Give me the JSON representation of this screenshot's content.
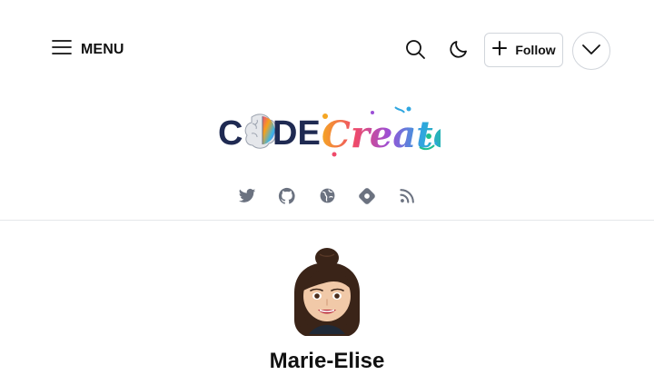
{
  "header": {
    "menu_label": "MENU",
    "follow_label": "Follow",
    "icons": {
      "menu": "hamburger-icon",
      "search": "search-icon",
      "theme": "moon-icon",
      "follow": "plus-icon",
      "more": "chevron-down-icon"
    }
  },
  "logo": {
    "text_left": "C",
    "text_mid": "DE",
    "text_script": "Create"
  },
  "social_links": [
    {
      "name": "twitter-icon"
    },
    {
      "name": "github-icon"
    },
    {
      "name": "globe-icon"
    },
    {
      "name": "hashnode-icon"
    },
    {
      "name": "rss-icon"
    }
  ],
  "profile": {
    "name": "Marie-Elise"
  },
  "colors": {
    "text": "#111827",
    "border": "#d1d5db",
    "icon_gray": "#6b7280",
    "logo_navy": "#1f2a52"
  }
}
